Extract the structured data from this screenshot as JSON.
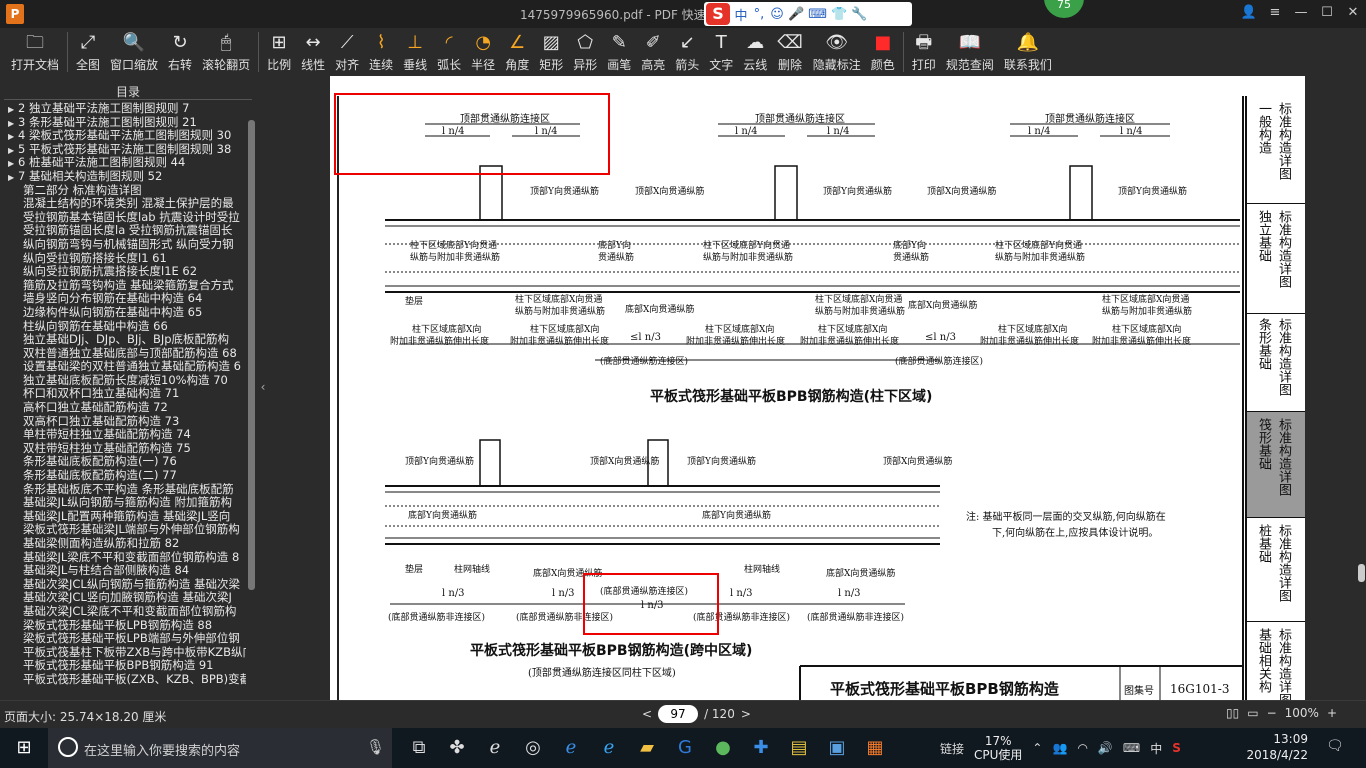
{
  "titlebar": {
    "logo": "P",
    "title": "1475979965960.pdf - PDF 快速看",
    "ime": {
      "logo": "S",
      "items": [
        "中",
        "°,",
        "☺",
        "🎤",
        "⌨",
        "👕",
        "🔧"
      ]
    },
    "badge": "75",
    "controls": [
      "👤",
      "≡",
      "—",
      "☐",
      "✕"
    ]
  },
  "toolbar": {
    "tools": [
      {
        "name": "open-file",
        "label": "打开文档",
        "icon": "🗀"
      },
      {
        "name": "fullscreen",
        "label": "全图",
        "icon": "⤢"
      },
      {
        "name": "window-zoom",
        "label": "窗口缩放",
        "icon": "🔍"
      },
      {
        "name": "rotate-right",
        "label": "右转",
        "icon": "↻"
      },
      {
        "name": "scroll-page",
        "label": "滚轮翻页",
        "icon": "🖱"
      },
      {
        "name": "scale",
        "label": "比例",
        "icon": "⊞"
      },
      {
        "name": "line-length",
        "label": "线性",
        "icon": "↔"
      },
      {
        "name": "align",
        "label": "对齐",
        "icon": "⟋"
      },
      {
        "name": "continuous",
        "label": "连续",
        "icon": "⌇"
      },
      {
        "name": "perpendicular",
        "label": "垂线",
        "icon": "⊥"
      },
      {
        "name": "arc-length",
        "label": "弧长",
        "icon": "◜"
      },
      {
        "name": "radius",
        "label": "半径",
        "icon": "◔"
      },
      {
        "name": "angle",
        "label": "角度",
        "icon": "∠"
      },
      {
        "name": "rectangle",
        "label": "矩形",
        "icon": "▨"
      },
      {
        "name": "irregular",
        "label": "异形",
        "icon": "⬠"
      },
      {
        "name": "pen",
        "label": "画笔",
        "icon": "✎"
      },
      {
        "name": "highlight",
        "label": "高亮",
        "icon": "✐"
      },
      {
        "name": "arrow",
        "label": "箭头",
        "icon": "↙"
      },
      {
        "name": "text",
        "label": "文字",
        "icon": "T"
      },
      {
        "name": "cloud-line",
        "label": "云线",
        "icon": "☁"
      },
      {
        "name": "delete",
        "label": "删除",
        "icon": "⌫"
      },
      {
        "name": "hide-annotations",
        "label": "隐藏标注",
        "icon": "👁"
      },
      {
        "name": "color",
        "label": "颜色",
        "icon": "■"
      },
      {
        "name": "print",
        "label": "打印",
        "icon": "🖶"
      },
      {
        "name": "spec-query",
        "label": "规范查阅",
        "icon": "📖"
      },
      {
        "name": "contact-us",
        "label": "联系我们",
        "icon": "🔔"
      }
    ]
  },
  "sidebar": {
    "title": "目录",
    "items": [
      {
        "arrow": "▶",
        "label": "2 独立基础平法施工图制图规则 7",
        "level": 0
      },
      {
        "arrow": "▶",
        "label": "3 条形基础平法施工图制图规则 21",
        "level": 0
      },
      {
        "arrow": "▶",
        "label": "4 梁板式筏形基础平法施工图制图规则 30",
        "level": 0
      },
      {
        "arrow": "▶",
        "label": "5 平板式筏形基础平法施工图制图规则 38",
        "level": 0
      },
      {
        "arrow": "▶",
        "label": "6 桩基础平法施工图制图规则 44",
        "level": 0
      },
      {
        "arrow": "▶",
        "label": "7 基础相关构造制图规则 52",
        "level": 0
      },
      {
        "arrow": "",
        "label": "第二部分 标准构造详图",
        "level": 1
      },
      {
        "arrow": "",
        "label": "混凝土结构的环境类别 混凝土保护层的最",
        "level": 1
      },
      {
        "arrow": "",
        "label": "受拉钢筋基本锚固长度lab 抗震设计时受拉",
        "level": 1
      },
      {
        "arrow": "",
        "label": "受拉钢筋锚固长度la 受拉钢筋抗震锚固长",
        "level": 1
      },
      {
        "arrow": "",
        "label": "纵向钢筋弯钩与机械锚固形式 纵向受力钢",
        "level": 1
      },
      {
        "arrow": "",
        "label": "纵向受拉钢筋搭接长度l1 61",
        "level": 1
      },
      {
        "arrow": "",
        "label": "纵向受拉钢筋抗震搭接长度l1E 62",
        "level": 1
      },
      {
        "arrow": "",
        "label": "箍筋及拉筋弯钩构造 基础梁箍筋复合方式",
        "level": 1
      },
      {
        "arrow": "",
        "label": "墙身竖向分布钢筋在基础中构造 64",
        "level": 1
      },
      {
        "arrow": "",
        "label": "边缘构件纵向钢筋在基础中构造 65",
        "level": 1
      },
      {
        "arrow": "",
        "label": "柱纵向钢筋在基础中构造 66",
        "level": 1
      },
      {
        "arrow": "",
        "label": "独立基础DJj、DJp、BJj、BJp底板配筋构",
        "level": 1
      },
      {
        "arrow": "",
        "label": "双柱普通独立基础底部与顶部配筋构造 68",
        "level": 1
      },
      {
        "arrow": "",
        "label": "设置基础梁的双柱普通独立基础配筋构造 6",
        "level": 1
      },
      {
        "arrow": "",
        "label": "独立基础底板配筋长度减短10%构造 70",
        "level": 1
      },
      {
        "arrow": "",
        "label": "杯口和双杯口独立基础构造 71",
        "level": 1
      },
      {
        "arrow": "",
        "label": "高杯口独立基础配筋构造 72",
        "level": 1
      },
      {
        "arrow": "",
        "label": "双高杯口独立基础配筋构造 73",
        "level": 1
      },
      {
        "arrow": "",
        "label": "单柱带短柱独立基础配筋构造 74",
        "level": 1
      },
      {
        "arrow": "",
        "label": "双柱带短柱独立基础配筋构造 75",
        "level": 1
      },
      {
        "arrow": "",
        "label": "条形基础底板配筋构造(一) 76",
        "level": 1
      },
      {
        "arrow": "",
        "label": "条形基础底板配筋构造(二) 77",
        "level": 1
      },
      {
        "arrow": "",
        "label": "条形基础板底不平构造 条形基础底板配筋",
        "level": 1
      },
      {
        "arrow": "",
        "label": "基础梁JL纵向钢筋与箍筋构造 附加箍筋构",
        "level": 1
      },
      {
        "arrow": "",
        "label": "基础梁JL配置两种箍筋构造 基础梁JL竖向",
        "level": 1
      },
      {
        "arrow": "",
        "label": "梁板式筏形基础梁JL端部与外伸部位钢筋构",
        "level": 1
      },
      {
        "arrow": "",
        "label": "基础梁侧面构造纵筋和拉筋 82",
        "level": 1
      },
      {
        "arrow": "",
        "label": "基础梁JL梁底不平和变截面部位钢筋构造 8",
        "level": 1
      },
      {
        "arrow": "",
        "label": "基础梁JL与柱结合部侧腋构造 84",
        "level": 1
      },
      {
        "arrow": "",
        "label": "基础次梁JCL纵向钢筋与箍筋构造 基础次梁",
        "level": 1
      },
      {
        "arrow": "",
        "label": "基础次梁JCL竖向加腋钢筋构造 基础次梁J",
        "level": 1
      },
      {
        "arrow": "",
        "label": "基础次梁JCL梁底不平和变截面部位钢筋构",
        "level": 1
      },
      {
        "arrow": "",
        "label": "梁板式筏形基础平板LPB钢筋构造 88",
        "level": 1
      },
      {
        "arrow": "",
        "label": "梁板式筏形基础平板LPB端部与外伸部位钢",
        "level": 1
      },
      {
        "arrow": "",
        "label": "平板式筏基柱下板带ZXB与跨中板带KZB纵向",
        "level": 1
      },
      {
        "arrow": "",
        "label": "平板式筏形基础平板BPB钢筋构造 91",
        "level": 1
      },
      {
        "arrow": "",
        "label": "平板式筏形基础平板(ZXB、KZB、BPB)变截",
        "level": 1
      }
    ]
  },
  "drawing": {
    "top_zone_label": "顶部贯通纵筋连接区",
    "ln4": "l n/4",
    "labels_top": {
      "top_y": "顶部Y向贯通纵筋",
      "top_x": "顶部X向贯通纵筋",
      "under_col_y": "柱下区域底部Y向贯通",
      "under_col_y2": "纵筋与附加非贯通纵筋",
      "bottom_y": "底部Y向",
      "bottom_y2": "贯通纵筋",
      "cushion": "垫层",
      "under_col_x": "柱下区域底部X向贯通",
      "under_col_x2": "纵筋与附加非贯通纵筋",
      "bottom_x": "底部X向贯通纵筋",
      "x_add": "柱下区域底部X向",
      "x_add2": "附加非贯通纵筋伸出长度",
      "ln3": "≤l n/3",
      "bottom_zone": "(底部贯通纵筋连接区)"
    },
    "heading1": "平板式筏形基础平板BPB钢筋构造(柱下区域)",
    "labels_bottom": {
      "top_y": "顶部Y向贯通纵筋",
      "top_x": "顶部X向贯通纵筋",
      "bottom_y": "底部Y向贯通纵筋",
      "cushion": "垫层",
      "column_strip": "柱网轴线",
      "bottom_x": "底部X向贯通纵筋",
      "ln3": "l n/3",
      "non_zone": "(底部贯通纵筋非连接区)",
      "zone": "(底部贯通纵筋连接区)"
    },
    "note": "注: 基础平板同一层面的交叉纵筋,何向纵筋在",
    "note2": "下,何向纵筋在上,应按具体设计说明。",
    "heading2": "平板式筏形基础平板BPB钢筋构造(跨中区域)",
    "heading2_sub": "(顶部贯通纵筋连接区同柱下区域)",
    "title_block": {
      "title": "平板式筏形基础平板BPB钢筋构造",
      "atlas_label": "图集号",
      "atlas_no": "16G101-3"
    },
    "side_tabs": [
      {
        "a": "标准构造详图",
        "b": "一般构造"
      },
      {
        "a": "标准构造详图",
        "b": "独立基础"
      },
      {
        "a": "标准构造详图",
        "b": "条形基础"
      },
      {
        "a": "标准构造详图",
        "b": "筏形基础"
      },
      {
        "a": "标准构造详图",
        "b": "桩基础"
      },
      {
        "a": "标准构造详图",
        "b": "基础相关构"
      }
    ]
  },
  "statusbar": {
    "page_size": "页面大小: 25.74×18.20 厘米",
    "prev": "<",
    "page_current": "97",
    "page_total": "/ 120",
    "next": ">",
    "zoom": "100%"
  },
  "taskbar": {
    "search_placeholder": "在这里输入你要搜索的内容",
    "tray_link": "链接",
    "cpu_percent": "17%",
    "cpu_label": "CPU使用",
    "lang": "中",
    "time": "13:09",
    "date": "2018/4/22"
  },
  "colors": {
    "accent": "#f5a623",
    "annotation_red": "#e00000",
    "ime_red": "#e5332a",
    "badge_green": "#3aa149"
  }
}
